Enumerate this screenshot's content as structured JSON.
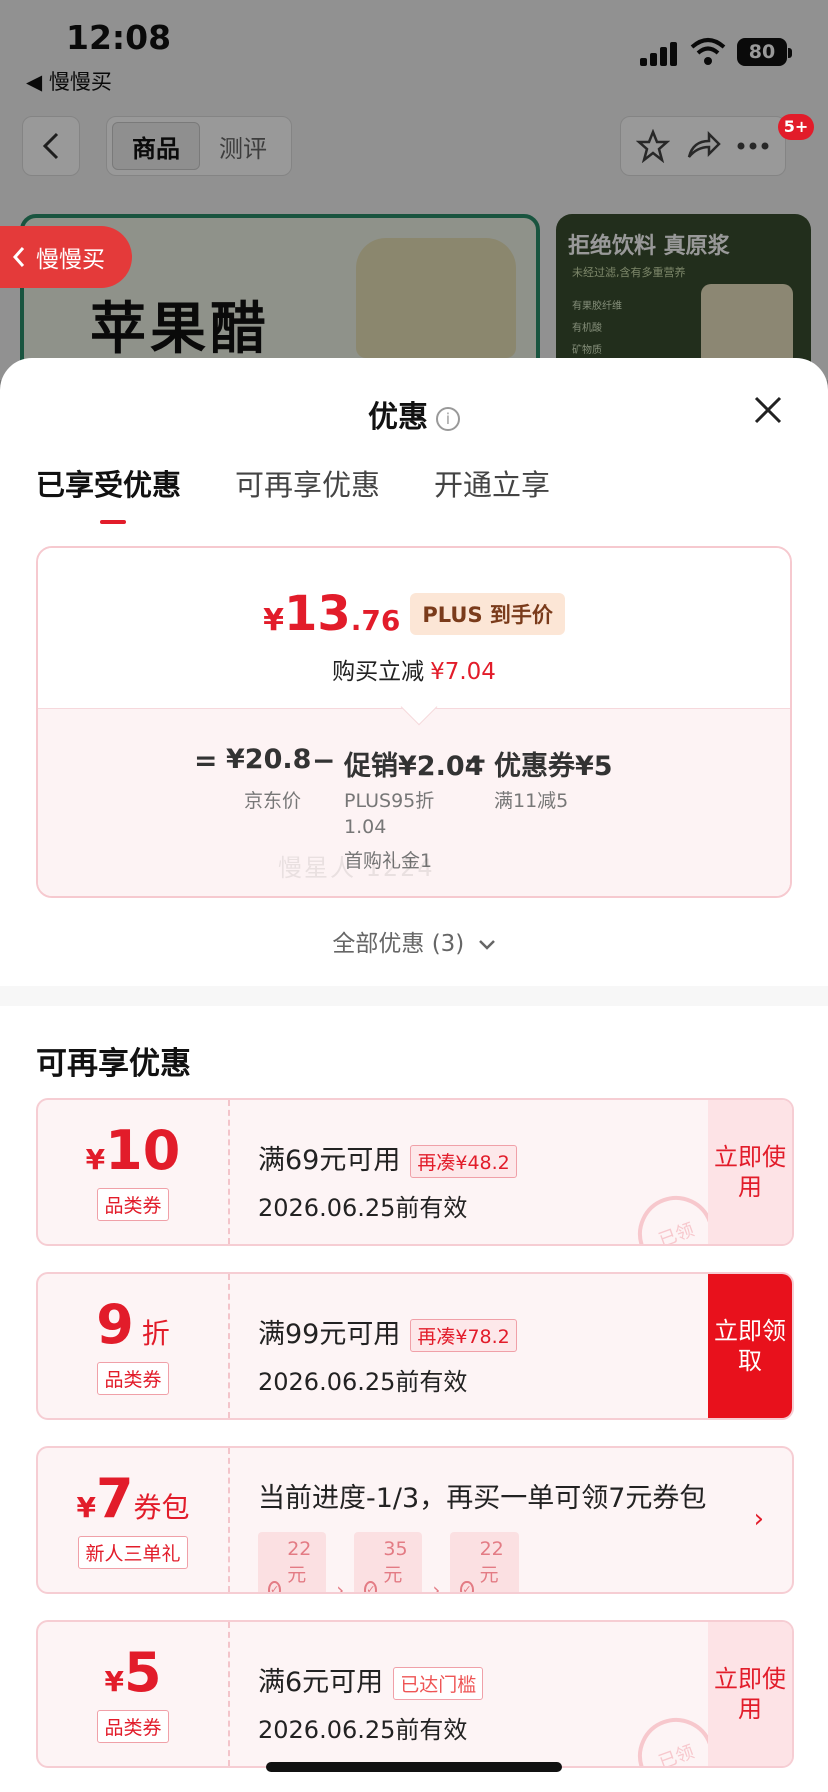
{
  "status_bar": {
    "time": "12:08",
    "back_app": "◀ 慢慢买",
    "battery": "80"
  },
  "nav": {
    "tab_goods": "商品",
    "tab_review": "测评",
    "badge": "5+"
  },
  "banners": {
    "left_title": "苹果醋",
    "right_title": "拒绝饮料 真原浆",
    "right_sub": "未经过滤,含有多重营养",
    "right_list": [
      "有果胶纤维",
      "有机酸",
      "矿物质"
    ]
  },
  "floating_back": "慢慢买",
  "sheet": {
    "title": "优惠",
    "tabs": [
      "已享受优惠",
      "可再享优惠",
      "开通立享"
    ],
    "summary": {
      "price_currency": "¥",
      "price_int": "13",
      "price_dec": ".76",
      "price_tag": "PLUS 到手价",
      "reduce_label": "购买立减",
      "reduce_amount": "¥7.04",
      "equals": "=",
      "base_price": "¥20.8",
      "base_label": "京东价",
      "minus1": "−",
      "promo": "促销¥2.04",
      "promo_detail1": "PLUS95折",
      "promo_detail1b": "1.04",
      "promo_detail2": "首购礼金1",
      "minus2": "−",
      "coupon": "优惠券¥5",
      "coupon_detail": "满11减5",
      "watermark": "慢星人 1224"
    },
    "all_deals": "全部优惠 (3)",
    "section_title": "可再享优惠",
    "coupons": [
      {
        "sym": "¥",
        "num": "10",
        "unit": "",
        "type": "品类券",
        "cond": "满69元可用",
        "tag": "再凑¥48.2",
        "date": "2026.06.25前有效",
        "action": "立即使用",
        "stamp": "已领"
      },
      {
        "sym": "",
        "num": "9",
        "unit": "折",
        "type": "品类券",
        "cond": "满99元可用",
        "tag": "再凑¥78.2",
        "date": "2026.06.25前有效",
        "action": "立即领取"
      },
      {
        "sym": "¥",
        "num": "7",
        "unit": "券包",
        "type": "新人三单礼",
        "progress": "当前进度-1/3，再买一单可领7元券包",
        "steps": [
          "22元券包",
          "35元券包",
          "22元券包"
        ]
      },
      {
        "sym": "¥",
        "num": "5",
        "unit": "",
        "type": "品类券",
        "cond": "满6元可用",
        "tag": "已达门槛",
        "date": "2026.06.25前有效",
        "action": "立即使用",
        "stamp": "已领"
      }
    ]
  }
}
